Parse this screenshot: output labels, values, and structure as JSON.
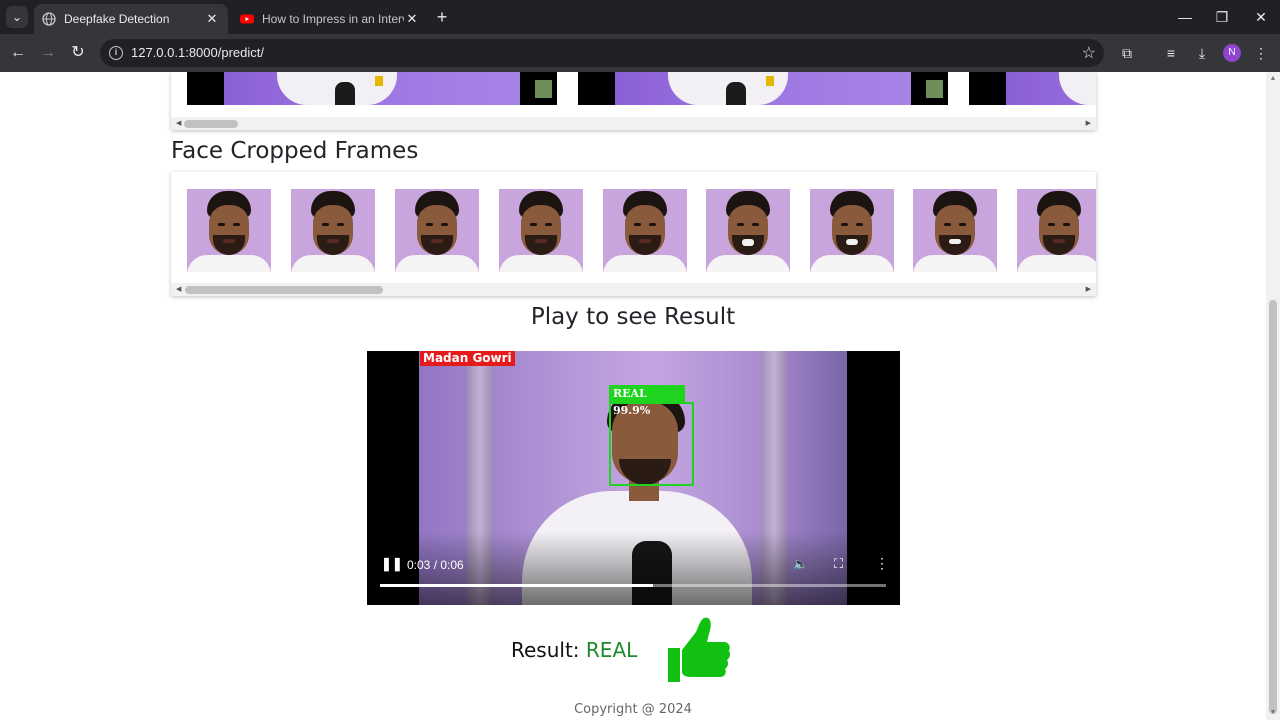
{
  "browser": {
    "tabs": [
      {
        "title": "Deepfake Detection",
        "active": true,
        "favicon": "globe-icon"
      },
      {
        "title": "How to Impress in an Interview",
        "active": false,
        "favicon": "youtube-icon"
      }
    ],
    "url": "127.0.0.1:8000/predict/",
    "profile_initial": "N",
    "accent": "#8e44ce"
  },
  "page": {
    "face_section_title": "Face Cropped Frames",
    "result_section_title": "Play to see Result",
    "video": {
      "channel_tag": "Madan Gowri",
      "detection_label": "REAL  99.9%",
      "time": "0:03 / 0:06",
      "progress": 0.54
    },
    "result": {
      "label": "Result: ",
      "value": "REAL",
      "value_color": "#1e8a2e",
      "icon": "thumbs-up-icon"
    },
    "footer": "Copyright @ 2024"
  }
}
